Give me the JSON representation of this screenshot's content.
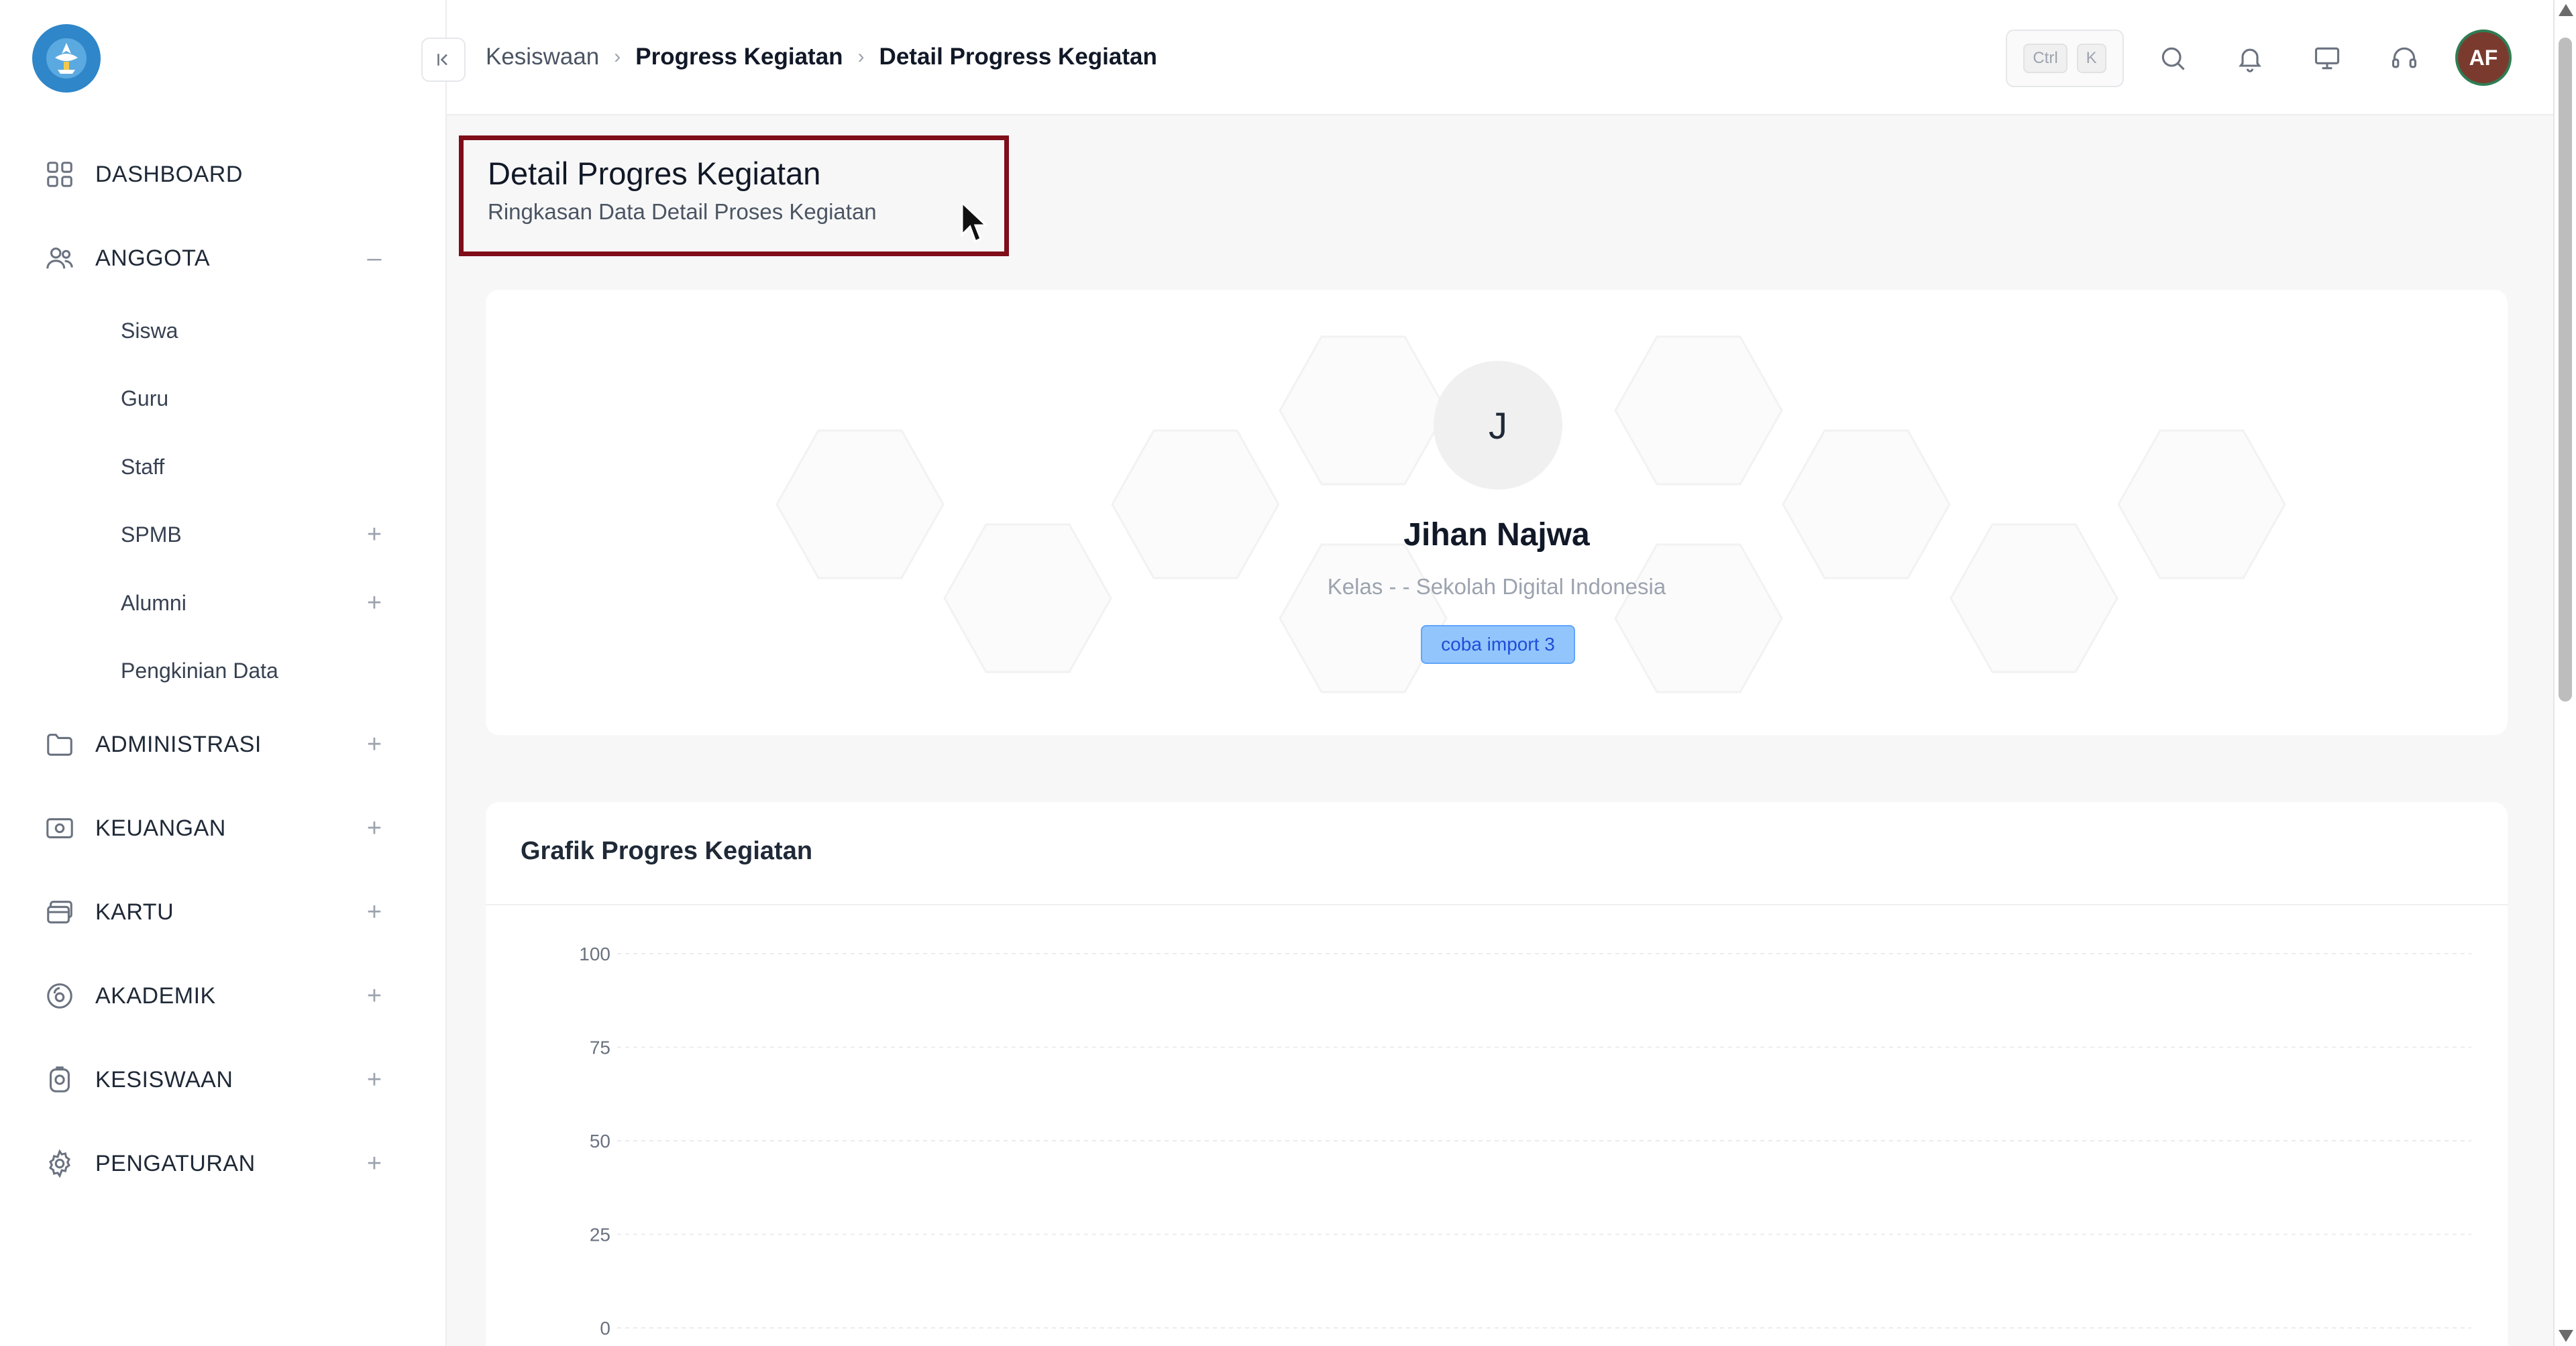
{
  "sidebar": {
    "logo_icon": "tut-wuri-handayani-logo",
    "items": [
      {
        "key": "dashboard",
        "label": "DASHBOARD",
        "icon": "grid-icon",
        "toggle": ""
      },
      {
        "key": "anggota",
        "label": "ANGGOTA",
        "icon": "users-icon",
        "toggle": "–"
      },
      {
        "key": "administrasi",
        "label": "ADMINISTRASI",
        "icon": "folder-icon",
        "toggle": "+"
      },
      {
        "key": "keuangan",
        "label": "KEUANGAN",
        "icon": "money-icon",
        "toggle": "+"
      },
      {
        "key": "kartu",
        "label": "KARTU",
        "icon": "card-icon",
        "toggle": "+"
      },
      {
        "key": "akademik",
        "label": "AKADEMIK",
        "icon": "academic-icon",
        "toggle": "+"
      },
      {
        "key": "kesiswaan",
        "label": "KESISWAAN",
        "icon": "student-icon",
        "toggle": "+"
      },
      {
        "key": "pengaturan",
        "label": "PENGATURAN",
        "icon": "gear-icon",
        "toggle": "+"
      }
    ],
    "anggota_sub": [
      {
        "label": "Siswa",
        "toggle": ""
      },
      {
        "label": "Guru",
        "toggle": ""
      },
      {
        "label": "Staff",
        "toggle": ""
      },
      {
        "label": "SPMB",
        "toggle": "+"
      },
      {
        "label": "Alumni",
        "toggle": "+"
      },
      {
        "label": "Pengkinian Data",
        "toggle": ""
      }
    ]
  },
  "topbar": {
    "collapse_icon": "collapse-left-icon",
    "breadcrumb": [
      "Kesiswaan",
      "Progress Kegiatan",
      "Detail Progress Kegiatan"
    ],
    "shortcut_keys": [
      "Ctrl",
      "K"
    ],
    "icons": [
      "search-icon",
      "bell-icon",
      "monitor-icon",
      "support-icon"
    ],
    "avatar_initials": "AF"
  },
  "page": {
    "title": "Detail Progres Kegiatan",
    "subtitle": "Ringkasan Data Detail Proses Kegiatan"
  },
  "profile": {
    "initial": "J",
    "name": "Jihan Najwa",
    "subtitle": "Kelas - - Sekolah Digital Indonesia",
    "badge": "coba import 3"
  },
  "chart_card": {
    "title": "Grafik Progres Kegiatan"
  },
  "chart_data": {
    "type": "line",
    "title": "Grafik Progres Kegiatan",
    "xlabel": "",
    "ylabel": "",
    "ylim": [
      0,
      100
    ],
    "yticks": [
      100,
      75,
      50,
      25,
      0
    ],
    "grid": true,
    "series": []
  },
  "colors": {
    "highlight_border": "#7f0d1a",
    "badge_bg": "#93c5fd",
    "avatar_bg": "#7a3b2e",
    "logo_blue": "#2f86c9"
  }
}
